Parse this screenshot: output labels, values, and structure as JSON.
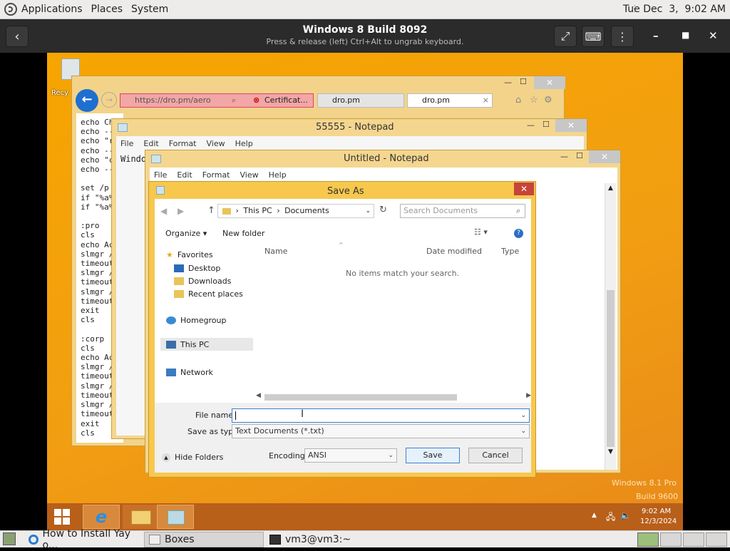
{
  "top_panel": {
    "applications": "Applications",
    "places": "Places",
    "system": "System",
    "clock": "Tue Dec  3,  9:02 AM"
  },
  "boxes": {
    "title": "Windows 8 Build 8092",
    "subtitle": "Press & release (left) Ctrl+Alt to ungrab keyboard."
  },
  "desktop": {
    "recycle_label": "Recy",
    "watermark_line1": "Windows 8.1 Pro",
    "watermark_line2": "Build 9600"
  },
  "ie": {
    "url": "https://dro.pm/aero",
    "cert_label": "Certificat...",
    "tab1": "dro.pm",
    "tab2": "dro.pm",
    "tab_close": "×"
  },
  "bg_console": {
    "lines": [
      "echo Ch",
      "echo --",
      "echo \"r",
      "echo --",
      "echo \"c",
      "echo --",
      "",
      "set /p",
      "if \"%a%",
      "if \"%a%",
      "",
      ":pro",
      "cls",
      "echo Ac",
      "slmgr /",
      "timeout",
      "slmgr /",
      "timeout",
      "slmgr /",
      "timeout",
      "exit",
      "cls",
      "",
      ":corp",
      "cls",
      "echo Ac",
      "slmgr /",
      "timeout",
      "slmgr /",
      "timeout",
      "slmgr /",
      "timeout",
      "exit",
      "cls"
    ]
  },
  "notepad1": {
    "title": "55555 - Notepad",
    "menu": [
      "File",
      "Edit",
      "Format",
      "View",
      "Help"
    ],
    "text": "Windo"
  },
  "notepad2": {
    "title": "Untitled - Notepad",
    "menu": [
      "File",
      "Edit",
      "Format",
      "View",
      "Help"
    ]
  },
  "saveas": {
    "title": "Save As",
    "breadcrumb_pc": "This PC",
    "breadcrumb_docs": "Documents",
    "search_placeholder": "Search Documents",
    "organize": "Organize",
    "new_folder": "New folder",
    "col_name": "Name",
    "col_date": "Date modified",
    "col_type": "Type",
    "empty_msg": "No items match your search.",
    "nav": {
      "favorites": "Favorites",
      "desktop": "Desktop",
      "downloads": "Downloads",
      "recent": "Recent places",
      "homegroup": "Homegroup",
      "thispc": "This PC",
      "network": "Network"
    },
    "file_name_label": "File name:",
    "file_name_value": "",
    "save_type_label": "Save as type:",
    "save_type_value": "Text Documents (*.txt)",
    "hide_folders": "Hide Folders",
    "encoding_label": "Encoding:",
    "encoding_value": "ANSI",
    "save": "Save",
    "cancel": "Cancel"
  },
  "win_taskbar": {
    "time": "9:02 AM",
    "date": "12/3/2024"
  },
  "gnome_taskbar": {
    "items": [
      "How to Install Yay o...",
      "Boxes",
      "vm3@vm3:~"
    ]
  }
}
